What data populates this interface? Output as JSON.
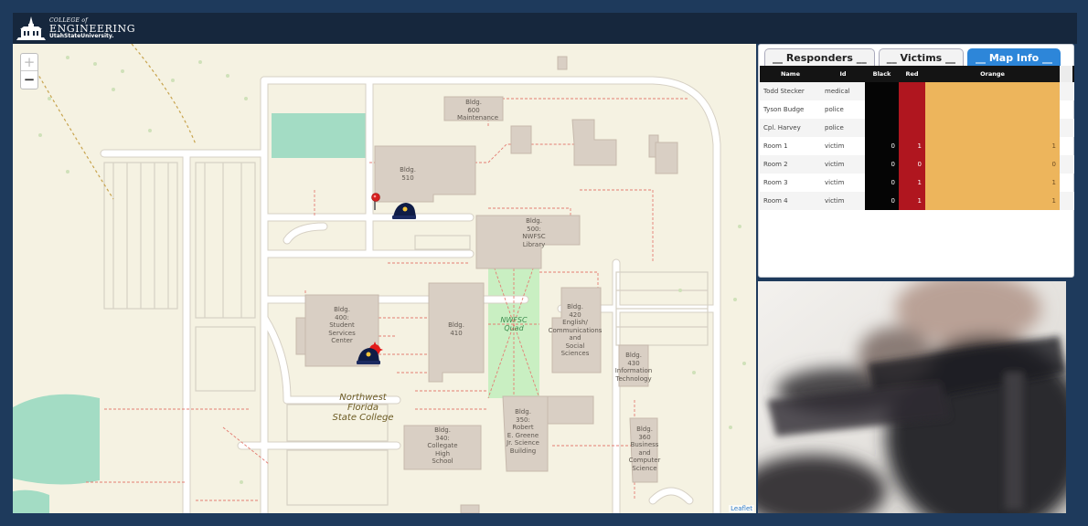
{
  "header": {
    "logo_college_of": "COLLEGE of",
    "logo_engineering": "ENGINEERING",
    "logo_university": "UtahStateUniversity."
  },
  "map": {
    "zoom_in": "+",
    "zoom_out": "−",
    "attribution": "Leaflet",
    "labels": {
      "b600": [
        "Bldg.",
        "600",
        "Maintenance"
      ],
      "b510": [
        "Bldg.",
        "510"
      ],
      "b500": [
        "Bldg.",
        "500:",
        "NWFSC",
        "Library"
      ],
      "b400": [
        "Bldg.",
        "400:",
        "Student",
        "Services",
        "Center"
      ],
      "b410": [
        "Bldg.",
        "410"
      ],
      "quad": [
        "NWFSC",
        "Quad"
      ],
      "b420": [
        "Bldg.",
        "420",
        "English/",
        "Communications",
        "and",
        "Social",
        "Sciences"
      ],
      "b430": [
        "Bldg.",
        "430",
        "Information",
        "Technology"
      ],
      "college": [
        "Northwest",
        "Florida",
        "State College"
      ],
      "b340": [
        "Bldg.",
        "340:",
        "Collegate",
        "High",
        "School"
      ],
      "b350": [
        "Bldg.",
        "350:",
        "Robert",
        "E. Greene",
        "Jr. Science",
        "Building"
      ],
      "b360": [
        "Bldg.",
        "360",
        "Business",
        "and",
        "Computer",
        "Science"
      ]
    }
  },
  "tabs": [
    "__ Responders __",
    "__ Victims __",
    "__ Map Info __"
  ],
  "active_tab": 2,
  "table": {
    "headers": [
      "Name",
      "Id",
      "Black",
      "Red",
      "Orange"
    ],
    "rows": [
      {
        "name": "Todd Stecker",
        "id": "medical",
        "black": "",
        "red": "",
        "orange": ""
      },
      {
        "name": "Tyson Budge",
        "id": "police",
        "black": "",
        "red": "",
        "orange": ""
      },
      {
        "name": "Cpl. Harvey",
        "id": "police",
        "black": "",
        "red": "",
        "orange": ""
      },
      {
        "name": "Room 1",
        "id": "victim",
        "black": "0",
        "red": "1",
        "orange": "1"
      },
      {
        "name": "Room 2",
        "id": "victim",
        "black": "0",
        "red": "0",
        "orange": "0"
      },
      {
        "name": "Room 3",
        "id": "victim",
        "black": "0",
        "red": "1",
        "orange": "1"
      },
      {
        "name": "Room 4",
        "id": "victim",
        "black": "0",
        "red": "1",
        "orange": "1"
      }
    ]
  },
  "colors": {
    "black_triage": "#050505",
    "red_triage": "#b0161f",
    "orange_triage": "#edb55c",
    "active_tab": "#2d86d9"
  }
}
